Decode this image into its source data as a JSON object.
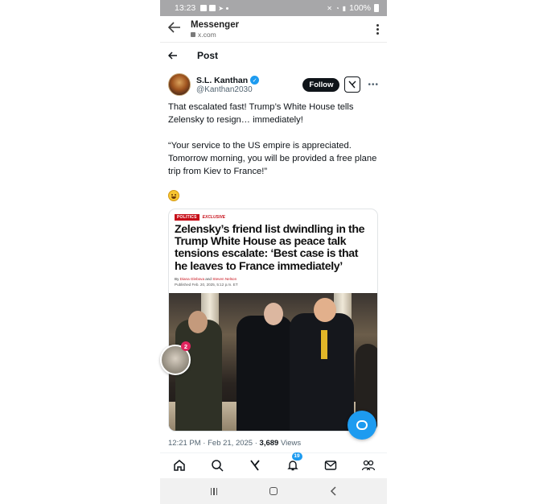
{
  "status_bar": {
    "time": "13:23",
    "battery": "100%"
  },
  "chrome": {
    "title": "Messenger",
    "url": "x.com"
  },
  "post_header": {
    "title": "Post"
  },
  "author": {
    "name": "S.L. Kanthan",
    "handle": "@Kanthan2030",
    "follow_label": "Follow",
    "grok_icon": "grok-icon"
  },
  "tweet": {
    "para1": "That escalated fast! Trump’s White House tells Zelensky to resign… immediately!",
    "para2": "“Your service to the US empire is appreciated. Tomorrow morning, you will be provided a free plane trip from Kiev to France!”",
    "emoji": "laughing-face-emoji"
  },
  "article_card": {
    "tag1": "POLITICS",
    "tag2": "EXCLUSIVE",
    "headline": "Zelensky’s friend list dwindling in the Trump White House as peace talk tensions escalate: ‘Best case is that he leaves to France immediately’",
    "by_prefix": "By ",
    "author1": "Diana Glebova",
    "and": " and ",
    "author2": "Steven Nelson",
    "published": "Published Feb. 20, 2025, 5:12 p.m. ET"
  },
  "floating_badge_count": "2",
  "meta": {
    "time": "12:21 PM · Feb 21, 2025 · ",
    "views_count": "3,689",
    "views_label": " Views"
  },
  "bottom_nav": {
    "notifications_badge": "19"
  },
  "colors": {
    "accent": "#1d9bf0",
    "brand_red": "#c7101a",
    "text": "#0f1419",
    "secondary": "#536471"
  }
}
